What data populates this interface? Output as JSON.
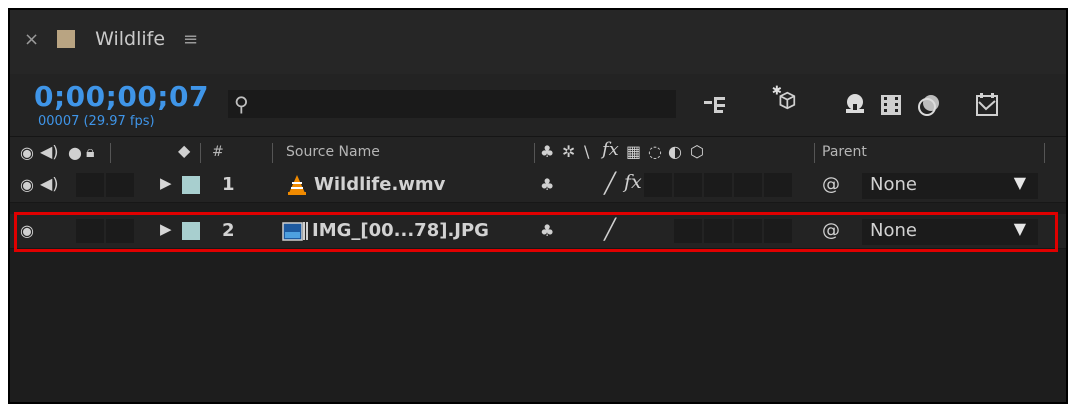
{
  "panel": {
    "tab_close": "×",
    "title": "Wildlife",
    "menu": "≡",
    "swatch_color": "#b9a482"
  },
  "time": {
    "timecode": "0;00;00;07",
    "frames": "00007 (29.97 fps)"
  },
  "search": {
    "placeholder": ""
  },
  "columns": {
    "num": "#",
    "source": "Source Name",
    "parent": "Parent"
  },
  "layers": [
    {
      "num": "1",
      "name": "Wildlife.wmv",
      "parent": "None",
      "icon": "vlc-cone-icon",
      "fx": "fx"
    },
    {
      "num": "2",
      "name": "IMG_[00...78].JPG",
      "parent": "None",
      "icon": "image-sequence-icon",
      "fx": ""
    }
  ],
  "colors": {
    "accent": "#3f95e8",
    "highlight": "#e00000",
    "label": "#a8cfcf"
  }
}
